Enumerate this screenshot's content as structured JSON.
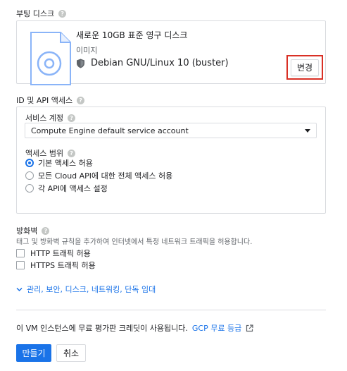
{
  "boot_disk": {
    "title": "부팅 디스크",
    "disk_name": "새로운 10GB 표준 영구 디스크",
    "image_label": "이미지",
    "os_name": "Debian GNU/Linux 10 (buster)",
    "change_label": "변경"
  },
  "identity_api": {
    "title": "ID 및 API 액세스",
    "service_account": {
      "label": "서비스 계정",
      "selected": "Compute Engine default service account"
    },
    "access_scope": {
      "label": "액세스 범위",
      "options": [
        {
          "label": "기본 액세스 허용",
          "selected": true
        },
        {
          "label": "모든 Cloud API에 대한 전체 액세스 허용",
          "selected": false
        },
        {
          "label": "각 API에 액세스 설정",
          "selected": false
        }
      ]
    }
  },
  "firewall": {
    "title": "방화벽",
    "description": "태그 및 방화벽 규칙을 추가하여 인터넷에서 특정 네트워크 트래픽을 허용합니다.",
    "http_label": "HTTP 트래픽 허용",
    "https_label": "HTTPS 트래픽 허용"
  },
  "management_link": "관리, 보안, 디스크, 네트워킹, 단독 임대",
  "free_trial": {
    "text": "이 VM 인스턴스에 무료 평가판 크레딧이 사용됩니다.",
    "link": "GCP 무료 등급"
  },
  "actions": {
    "create": "만들기",
    "cancel": "취소"
  },
  "colors": {
    "accent": "#1a73e8",
    "highlight": "#d93025",
    "border": "#dadce0"
  }
}
